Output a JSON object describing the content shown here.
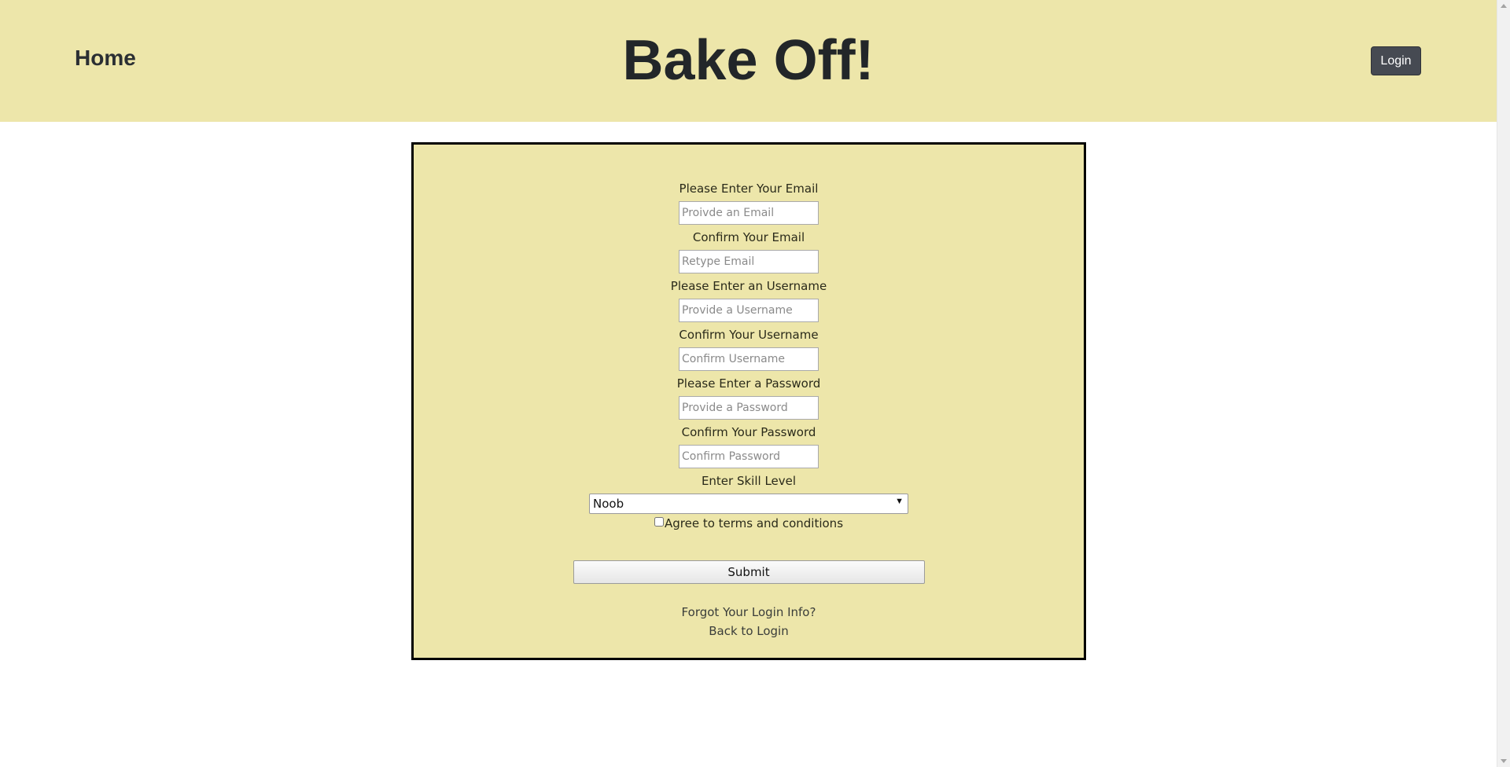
{
  "navbar": {
    "home_label": "Home",
    "title": "Bake Off!",
    "login_label": "Login"
  },
  "form": {
    "email_label": "Please Enter Your Email",
    "email_placeholder": "Proivde an Email",
    "confirm_email_label": "Confirm Your Email",
    "confirm_email_placeholder": "Retype Email",
    "username_label": "Please Enter an Username",
    "username_placeholder": "Provide a Username",
    "confirm_username_label": "Confirm Your Username",
    "confirm_username_placeholder": "Confirm Username",
    "password_label": "Please Enter a Password",
    "password_placeholder": "Provide a Password",
    "confirm_password_label": "Confirm Your Password",
    "confirm_password_placeholder": "Confirm Password",
    "skill_label": "Enter Skill Level",
    "skill_selected": "Noob",
    "terms_label": "Agree to terms and conditions",
    "terms_checked": false,
    "submit_label": "Submit",
    "forgot_link": "Forgot Your Login Info?",
    "back_link": "Back to Login"
  },
  "colors": {
    "panel_bg": "#ede6aa",
    "login_button_bg": "#464a52",
    "border": "#000000"
  }
}
